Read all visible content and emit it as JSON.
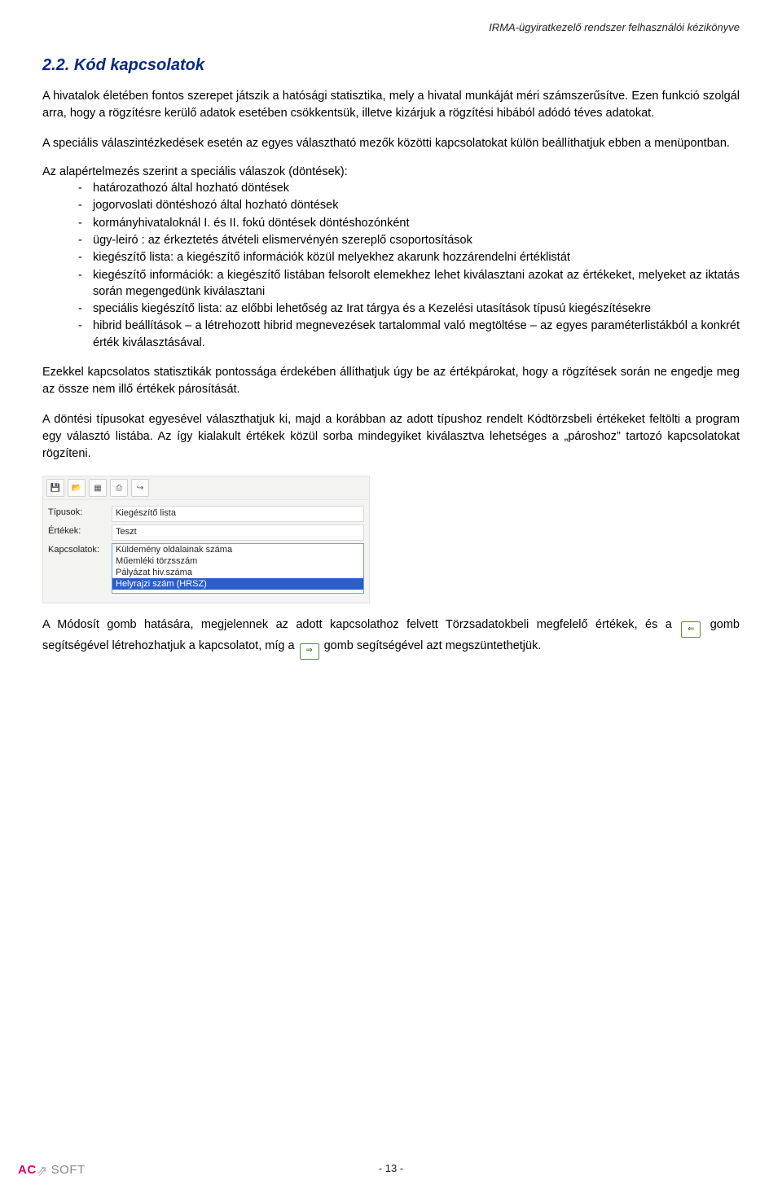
{
  "header": {
    "running": "IRMA-ügyiratkezelő rendszer felhasználói kézikönyve"
  },
  "section": {
    "number_title": "2.2. Kód kapcsolatok"
  },
  "paragraphs": {
    "p1": "A hivatalok életében fontos szerepet játszik a hatósági statisztika, mely a hivatal munkáját méri számszerűsítve. Ezen funkció szolgál arra, hogy a rögzítésre kerülő adatok esetében csökkentsük, illetve kizárjuk a rögzítési hibából adódó téves adatokat.",
    "p2": "A speciális válaszintézkedések esetén az egyes választható mezők közötti kapcsolatokat külön beállíthatjuk ebben a menüpontban.",
    "intro": "Az alapértelmezés szerint a speciális válaszok (döntések):",
    "p3": "Ezekkel kapcsolatos statisztikák pontossága érdekében állíthatjuk úgy be az értékpárokat, hogy a rögzítések során ne engedje meg az össze nem illő értékek párosítását.",
    "p4": "A döntési típusokat egyesével választhatjuk ki, majd a korábban az adott típushoz rendelt Kódtörzsbeli értékeket feltölti a program egy választó listába. Az így kialakult értékek közül sorba mindegyiket kiválasztva lehetséges a „pároshoz” tartozó kapcsolatokat rögzíteni.",
    "p5a": "A Módosít gomb hatására, megjelennek az adott kapcsolathoz felvett Törzsadatokbeli megfelelő értékek, és a ",
    "p5b": " gomb segítségével létrehozhatjuk a kapcsolatot, míg a ",
    "p5c": " gomb segítségével azt megszüntethetjük."
  },
  "list": {
    "items": [
      "határozathozó által hozható döntések",
      "jogorvoslati döntéshozó által hozható döntések",
      "kormányhivataloknál I. és II. fokú döntések döntéshozónként",
      "ügy-leiró : az érkeztetés átvételi elismervényén szereplő csoportosítások",
      "kiegészítő lista: a kiegészítő információk közül melyekhez akarunk hozzárendelni értéklistát",
      "kiegészítő információk: a kiegészítő listában felsorolt elemekhez lehet kiválasztani azokat az értékeket, melyeket az iktatás során megengedünk kiválasztani",
      "speciális kiegészítő lista: az előbbi lehetőség az Irat tárgya és a Kezelési utasítások típusú kiegészítésekre",
      "hibrid beállítások – a létrehozott hibrid megnevezések tartalommal való megtöltése – az egyes paraméterlistákból a konkrét érték kiválasztásával."
    ]
  },
  "ui": {
    "toolbar_icons": [
      "save-icon",
      "open-icon",
      "grid-icon",
      "print-icon",
      "exit-icon"
    ],
    "labels": {
      "tipusok": "Típusok:",
      "ertekek": "Értékek:",
      "kapcsolatok": "Kapcsolatok:"
    },
    "values": {
      "tipusok": "Kiegészítő lista",
      "ertekek": "Teszt"
    },
    "kapcsolatok_items": [
      {
        "text": "Küldemény oldalainak száma",
        "selected": false
      },
      {
        "text": "Műemléki törzsszám",
        "selected": false
      },
      {
        "text": "Pályázat hiv.száma",
        "selected": false
      },
      {
        "text": "Helyrajzi szám (HRSZ)",
        "selected": true
      }
    ]
  },
  "inline_buttons": {
    "add": "⇐",
    "remove": "⇒"
  },
  "footer": {
    "page": "- 13 -",
    "logo_ac": "AC",
    "logo_zig": "⇗",
    "logo_soft": "SOFT"
  }
}
